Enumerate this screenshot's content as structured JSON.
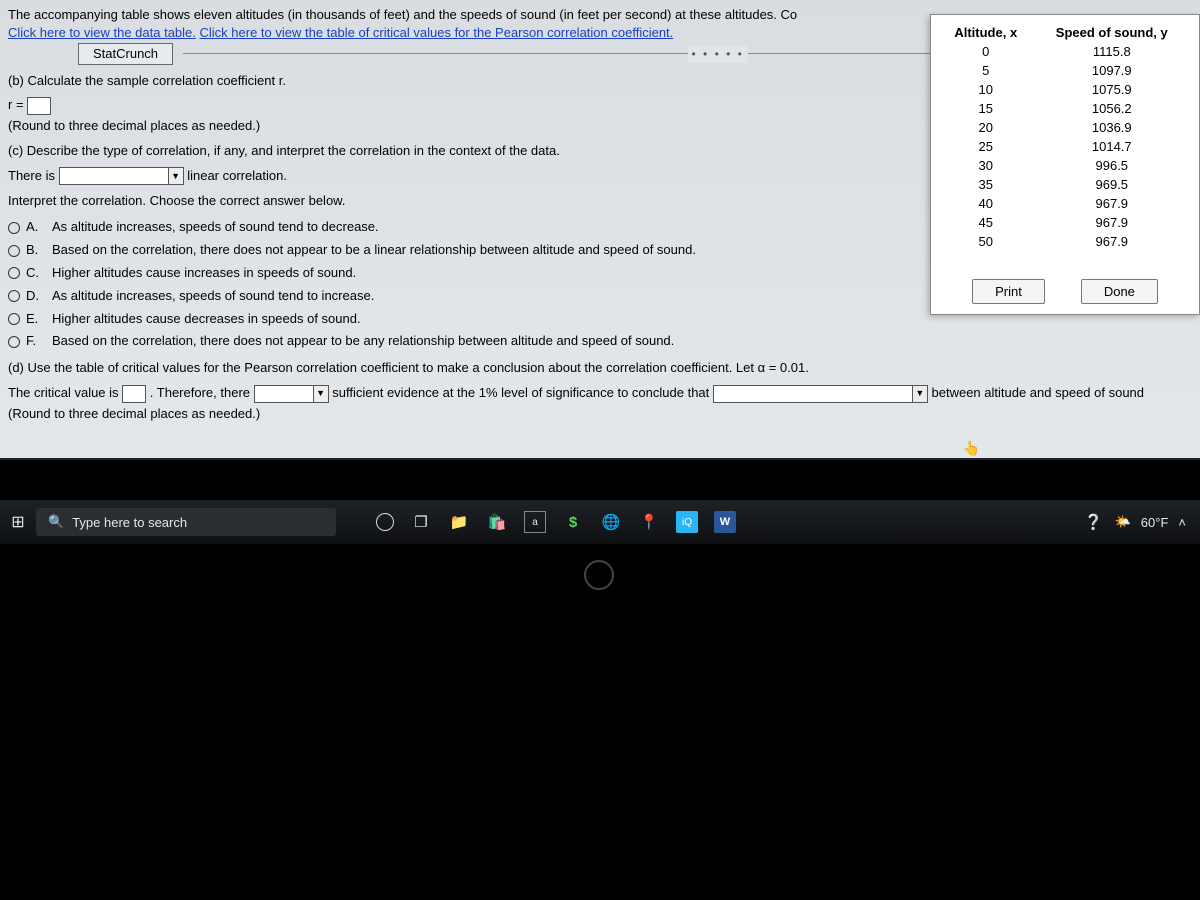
{
  "intro": {
    "line1": "The accompanying table shows eleven altitudes (in thousands of feet) and the speeds of sound (in feet per second) at these altitudes. Co",
    "link1": "Click here to view the data table.",
    "link2": "Click here to view the table of critical values for the Pearson correlation coefficient.",
    "statcrunch": "StatCrunch"
  },
  "partB": {
    "prompt": "(b) Calculate the sample correlation coefficient r.",
    "r_label": "r =",
    "round": "(Round to three decimal places as needed.)"
  },
  "partC": {
    "prompt": "(c) Describe the type of correlation, if any, and interpret the correlation in the context of the data.",
    "thereis": "There is",
    "after": "linear correlation.",
    "interpret": "Interpret the correlation. Choose the correct answer below.",
    "options": [
      "As altitude increases, speeds of sound tend to decrease.",
      "Based on the correlation, there does not appear to be a linear relationship between altitude and speed of sound.",
      "Higher altitudes cause increases in speeds of sound.",
      "As altitude increases, speeds of sound tend to increase.",
      "Higher altitudes cause decreases in speeds of sound.",
      "Based on the correlation, there does not appear to be any relationship between altitude and speed of sound."
    ],
    "letters": [
      "A.",
      "B.",
      "C.",
      "D.",
      "E.",
      "F."
    ]
  },
  "partD": {
    "prompt": "(d) Use the table of critical values for the Pearson correlation coefficient to make a conclusion about the correlation coefficient. Let α = 0.01.",
    "crit1": "The critical value is",
    "crit2": ". Therefore, there",
    "crit3": "sufficient evidence at the 1% level of significance to conclude that",
    "crit_tail": "between altitude and speed of sound",
    "round": "(Round to three decimal places as needed.)"
  },
  "table": {
    "h1": "Altitude, x",
    "h2": "Speed of sound, y",
    "rows": [
      [
        "0",
        "1115.8"
      ],
      [
        "5",
        "1097.9"
      ],
      [
        "10",
        "1075.9"
      ],
      [
        "15",
        "1056.2"
      ],
      [
        "20",
        "1036.9"
      ],
      [
        "25",
        "1014.7"
      ],
      [
        "30",
        "996.5"
      ],
      [
        "35",
        "969.5"
      ],
      [
        "40",
        "967.9"
      ],
      [
        "45",
        "967.9"
      ],
      [
        "50",
        "967.9"
      ]
    ],
    "print": "Print",
    "done": "Done"
  },
  "taskbar": {
    "search_placeholder": "Type here to search",
    "temp": "60°F"
  },
  "chart_data": {
    "type": "table",
    "title": "Altitude vs Speed of sound",
    "xlabel": "Altitude, x (thousands of feet)",
    "ylabel": "Speed of sound, y (ft/s)",
    "x": [
      0,
      5,
      10,
      15,
      20,
      25,
      30,
      35,
      40,
      45,
      50
    ],
    "y": [
      1115.8,
      1097.9,
      1075.9,
      1056.2,
      1036.9,
      1014.7,
      996.5,
      969.5,
      967.9,
      967.9,
      967.9
    ]
  }
}
